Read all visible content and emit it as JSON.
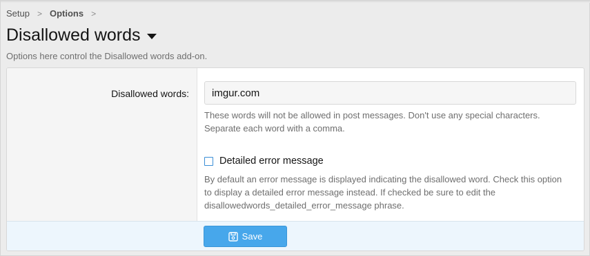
{
  "breadcrumb": {
    "items": [
      "Setup",
      "Options"
    ],
    "separator": ">"
  },
  "page": {
    "title": "Disallowed words",
    "description": "Options here control the Disallowed words add-on."
  },
  "options": {
    "disallowed_words": {
      "label": "Disallowed words:",
      "value": "imgur.com",
      "hint_line1": "These words will not be allowed in post messages. Don't use any special characters.",
      "hint_line2": "Separate each word with a comma."
    },
    "detailed_error": {
      "label": "Detailed error message",
      "checked": false,
      "hint_line1": "By default an error message is displayed indicating the disallowed word. Check this option",
      "hint_line2": "to display a detailed error message instead. If checked be sure to edit the",
      "hint_line3": "disallowedwords_detailed_error_message phrase."
    }
  },
  "footer": {
    "save_label": "Save"
  },
  "icons": {
    "title_dropdown": "caret-down-icon",
    "save": "floppy-disk-icon"
  },
  "colors": {
    "accent": "#47a7eb",
    "checkbox_border": "#3a8ed6",
    "footer_bg": "#edf6fd"
  }
}
